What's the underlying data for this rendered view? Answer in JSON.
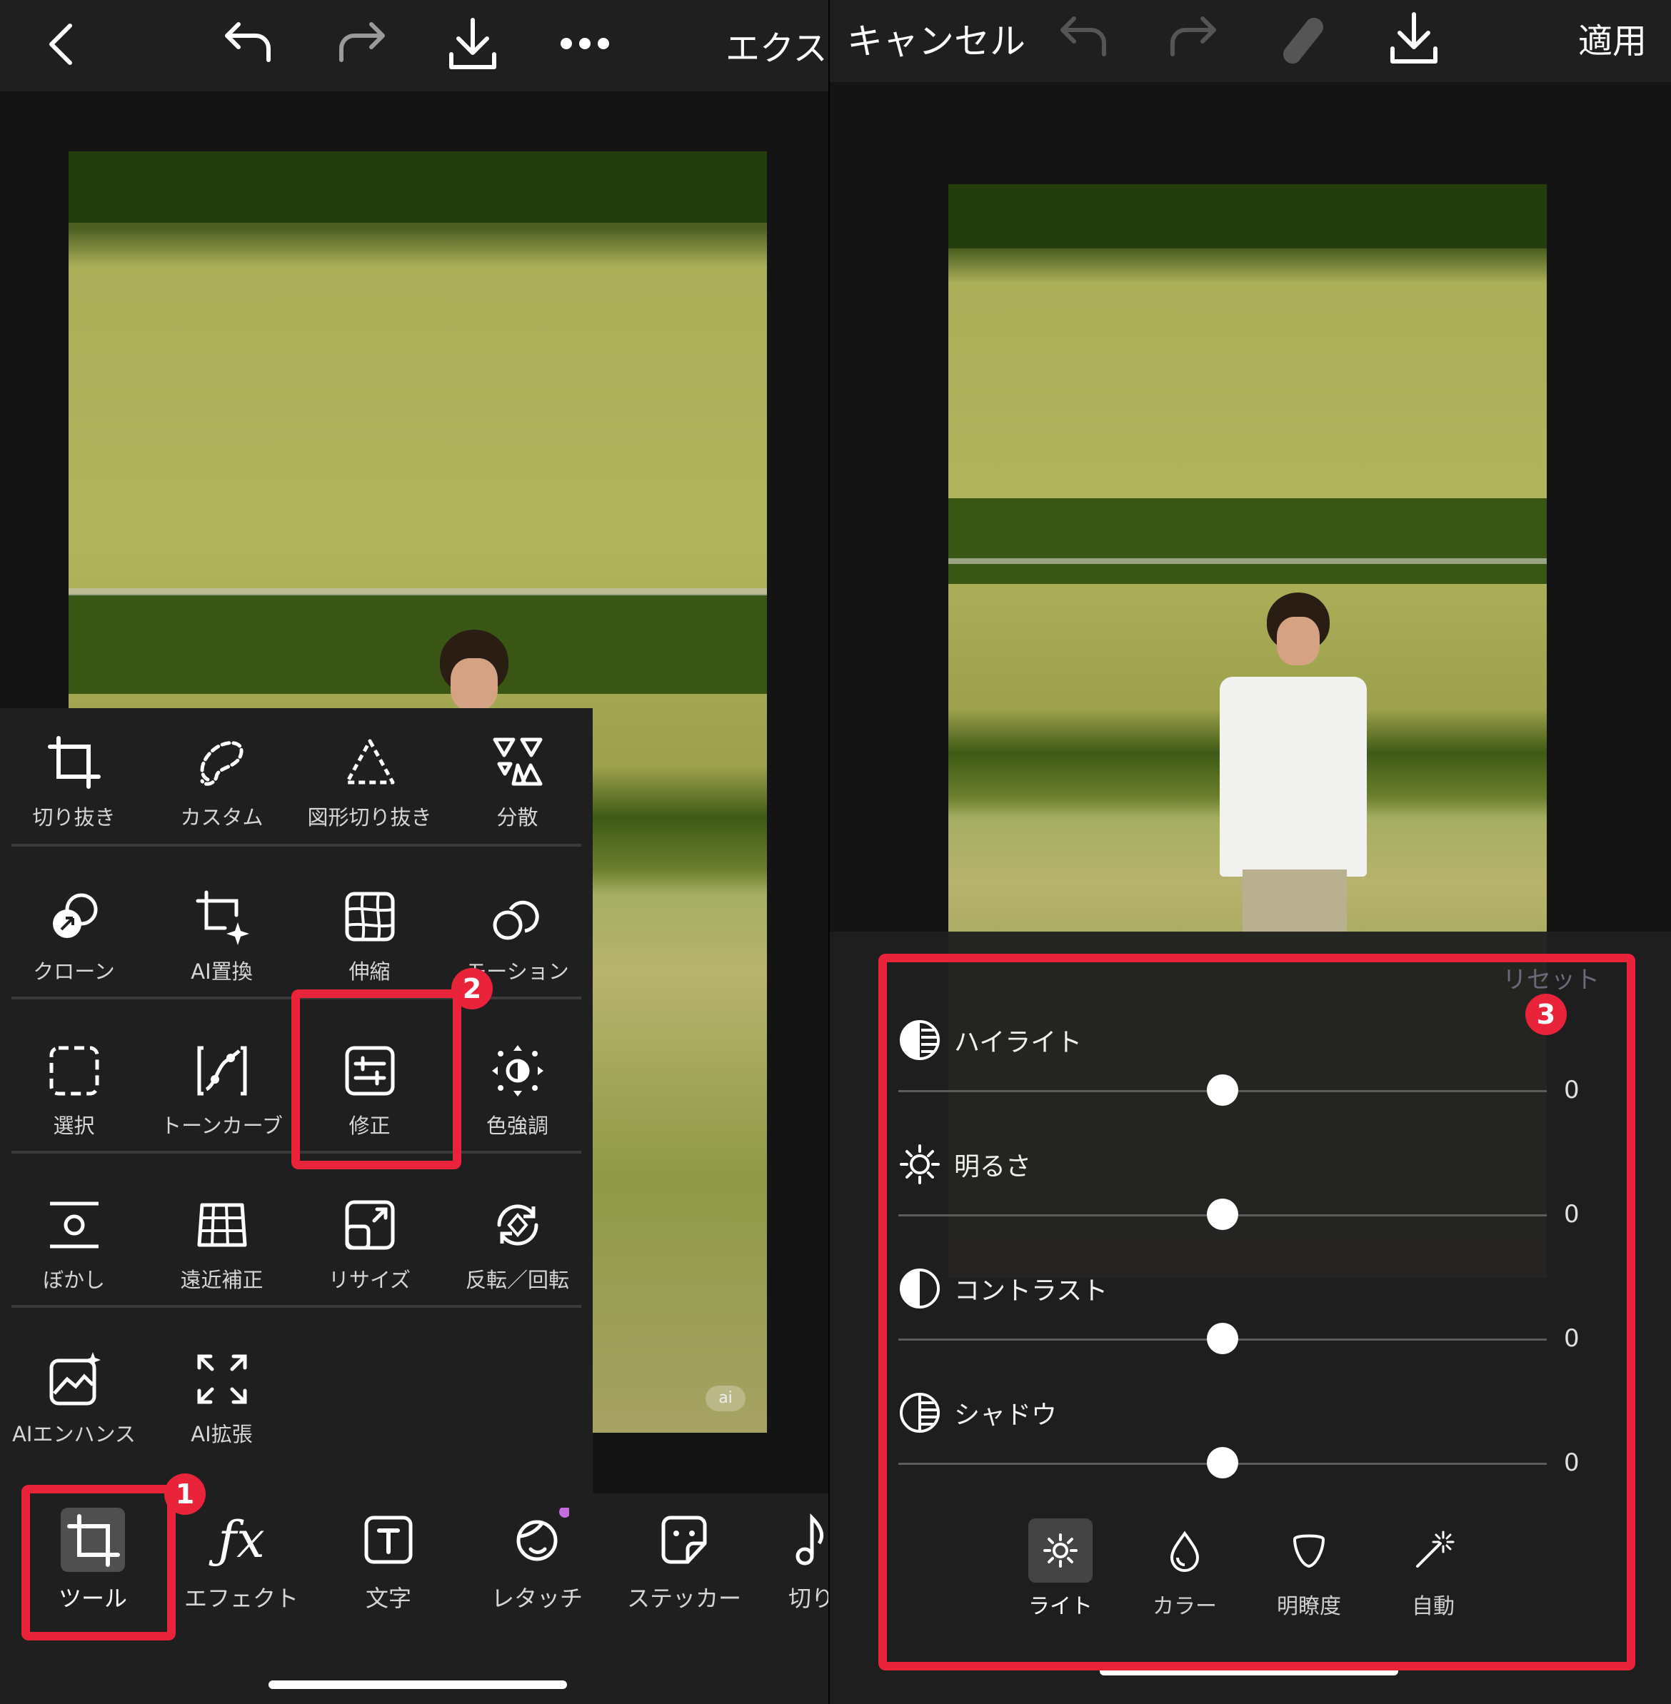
{
  "left": {
    "topbar": {
      "back_icon": "chevron-left-icon",
      "undo_icon": "undo-icon",
      "redo_icon": "redo-icon",
      "download_icon": "download-icon",
      "more_icon": "more-icon",
      "export_label": "エクス"
    },
    "tools": [
      {
        "label": "切り抜き",
        "icon": "crop-icon"
      },
      {
        "label": "カスタム",
        "icon": "lasso-icon"
      },
      {
        "label": "図形切り抜き",
        "icon": "shape-crop-icon"
      },
      {
        "label": "分散",
        "icon": "dispersion-icon"
      },
      {
        "label": "クローン",
        "icon": "clone-icon"
      },
      {
        "label": "AI置換",
        "icon": "ai-replace-icon"
      },
      {
        "label": "伸縮",
        "icon": "stretch-icon"
      },
      {
        "label": "モーション",
        "icon": "motion-icon"
      },
      {
        "label": "選択",
        "icon": "select-icon"
      },
      {
        "label": "トーンカーブ",
        "icon": "tone-curve-icon"
      },
      {
        "label": "修正",
        "icon": "adjust-icon"
      },
      {
        "label": "色強調",
        "icon": "color-emphasis-icon"
      },
      {
        "label": "ぼかし",
        "icon": "blur-icon"
      },
      {
        "label": "遠近補正",
        "icon": "perspective-icon"
      },
      {
        "label": "リサイズ",
        "icon": "resize-icon"
      },
      {
        "label": "反転／回転",
        "icon": "flip-rotate-icon"
      },
      {
        "label": "AIエンハンス",
        "icon": "ai-enhance-icon"
      },
      {
        "label": "AI拡張",
        "icon": "ai-expand-icon"
      }
    ],
    "bottom_nav": [
      {
        "label": "ツール",
        "icon": "crop-icon"
      },
      {
        "label": "エフェクト",
        "icon": "fx-icon"
      },
      {
        "label": "文字",
        "icon": "text-icon"
      },
      {
        "label": "レタッチ",
        "icon": "retouch-icon"
      },
      {
        "label": "ステッカー",
        "icon": "sticker-icon"
      },
      {
        "label": "切り",
        "icon": "cut-icon"
      }
    ],
    "badges": [
      "1",
      "2"
    ]
  },
  "right": {
    "topbar": {
      "cancel_label": "キャンセル",
      "undo_icon": "undo-icon",
      "redo_icon": "redo-icon",
      "eraser_icon": "eraser-icon",
      "download_icon": "download-icon",
      "apply_label": "適用"
    },
    "reset_label": "リセット",
    "sliders": [
      {
        "label": "ハイライト",
        "value": "0",
        "icon": "highlight-icon",
        "level": 0.5
      },
      {
        "label": "明るさ",
        "value": "0",
        "icon": "brightness-icon",
        "level": 0.5
      },
      {
        "label": "コントラスト",
        "value": "0",
        "icon": "contrast-icon",
        "level": 0.5
      },
      {
        "label": "シャドウ",
        "value": "0",
        "icon": "shadow-icon",
        "level": 0.5
      }
    ],
    "tabs": [
      {
        "label": "ライト",
        "icon": "light-icon",
        "active": true
      },
      {
        "label": "カラー",
        "icon": "droplet-icon",
        "active": false
      },
      {
        "label": "明瞭度",
        "icon": "clarity-icon",
        "active": false
      },
      {
        "label": "自動",
        "icon": "magic-wand-icon",
        "active": false
      }
    ],
    "badge": "3"
  },
  "photo_watermark": "ai",
  "colors": {
    "accent_red": "#e8233a",
    "panel": "#1f1f1f",
    "background": "#141414"
  }
}
